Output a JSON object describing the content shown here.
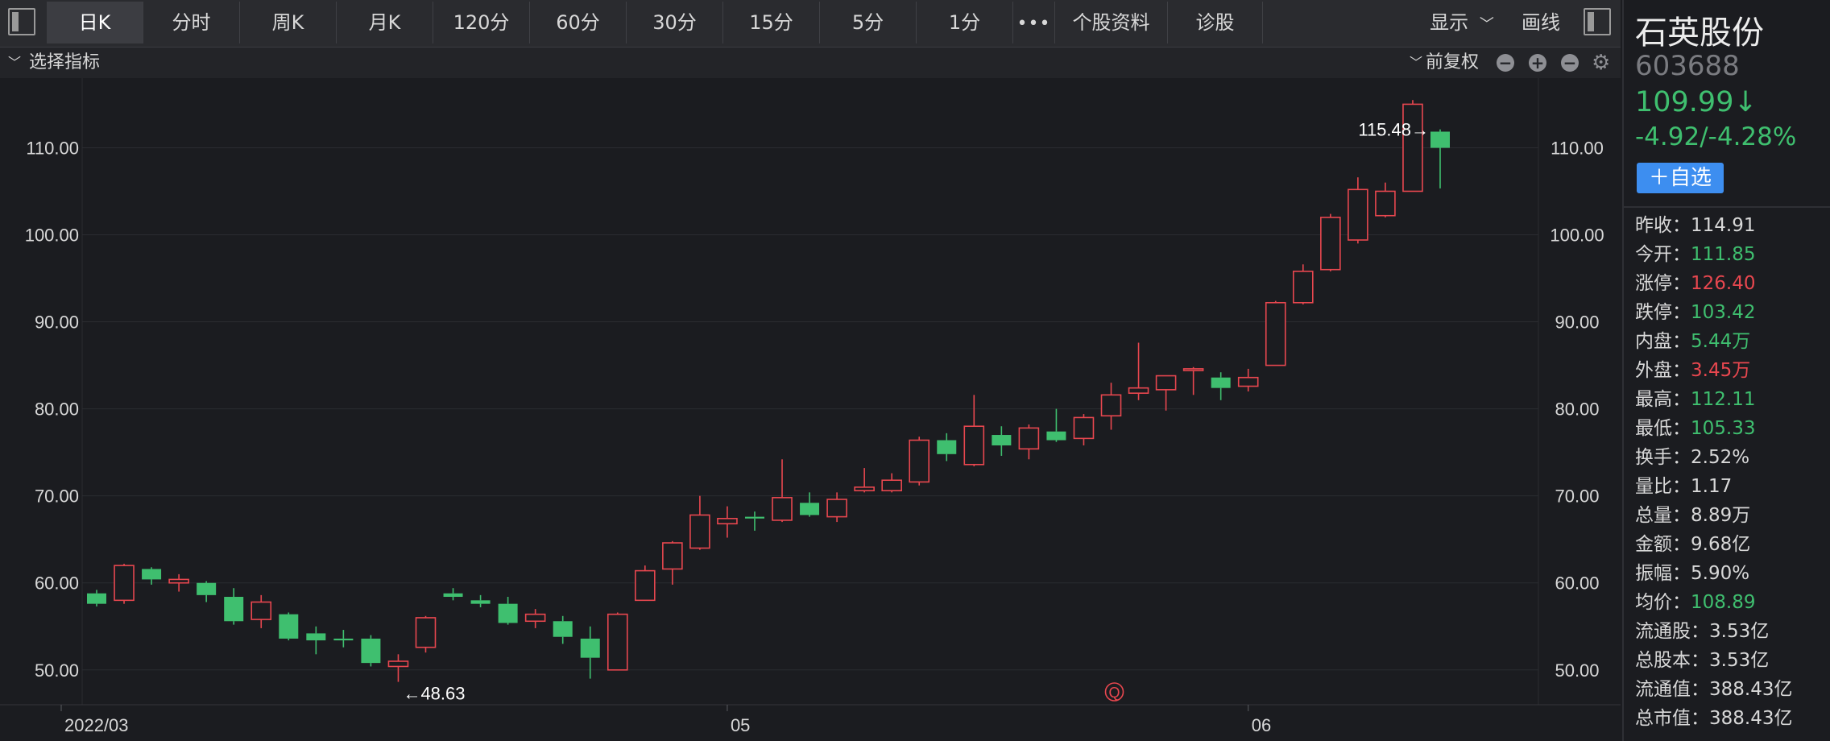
{
  "toolbar": {
    "tabs": [
      "日K",
      "分时",
      "周K",
      "月K",
      "120分",
      "60分",
      "30分",
      "15分",
      "5分",
      "1分"
    ],
    "active_tab": "日K",
    "more": "•••",
    "profile": "个股资料",
    "diagnose": "诊股",
    "display": "显示",
    "draw": "画线"
  },
  "subbar": {
    "indicator": "选择指标",
    "adjust": "前复权"
  },
  "chart_data": {
    "type": "candlestick",
    "ylim": [
      46,
      118
    ],
    "y_ticks": [
      "50.00",
      "60.00",
      "70.00",
      "80.00",
      "90.00",
      "100.00",
      "110.00"
    ],
    "x_labels": [
      {
        "index": 0,
        "label": "2022/03"
      },
      {
        "index": 23,
        "label": "05"
      },
      {
        "index": 42,
        "label": "06"
      }
    ],
    "max_marker": {
      "index": 49,
      "label": "115.48→"
    },
    "min_marker": {
      "index": 11,
      "label": "←48.63"
    },
    "event_marker": {
      "index": 37,
      "label": "Q"
    },
    "up_color": "#e8474f",
    "down_color": "#3fbf6f",
    "candles": [
      {
        "o": 58.8,
        "c": 57.6,
        "h": 59.2,
        "l": 57.3
      },
      {
        "o": 58.0,
        "c": 62.0,
        "h": 62.2,
        "l": 57.6
      },
      {
        "o": 61.6,
        "c": 60.4,
        "h": 61.8,
        "l": 59.8
      },
      {
        "o": 60.0,
        "c": 60.4,
        "h": 61.0,
        "l": 59.0
      },
      {
        "o": 60.0,
        "c": 58.6,
        "h": 60.2,
        "l": 57.8
      },
      {
        "o": 58.4,
        "c": 55.6,
        "h": 59.4,
        "l": 55.2
      },
      {
        "o": 55.8,
        "c": 57.8,
        "h": 58.6,
        "l": 54.8
      },
      {
        "o": 56.4,
        "c": 53.6,
        "h": 56.6,
        "l": 53.4
      },
      {
        "o": 54.2,
        "c": 53.4,
        "h": 55.0,
        "l": 51.8
      },
      {
        "o": 53.6,
        "c": 53.4,
        "h": 54.6,
        "l": 52.6
      },
      {
        "o": 53.6,
        "c": 50.8,
        "h": 54.0,
        "l": 50.4
      },
      {
        "o": 50.4,
        "c": 51.0,
        "h": 51.8,
        "l": 48.63
      },
      {
        "o": 52.6,
        "c": 56.0,
        "h": 56.2,
        "l": 52.0
      },
      {
        "o": 58.8,
        "c": 58.4,
        "h": 59.4,
        "l": 58.0
      },
      {
        "o": 58.0,
        "c": 57.6,
        "h": 58.6,
        "l": 57.2
      },
      {
        "o": 57.6,
        "c": 55.4,
        "h": 58.4,
        "l": 55.2
      },
      {
        "o": 55.6,
        "c": 56.4,
        "h": 57.0,
        "l": 54.8
      },
      {
        "o": 55.6,
        "c": 53.8,
        "h": 56.2,
        "l": 53.0
      },
      {
        "o": 53.6,
        "c": 51.4,
        "h": 55.0,
        "l": 49.0
      },
      {
        "o": 50.0,
        "c": 56.4,
        "h": 56.6,
        "l": 50.0
      },
      {
        "o": 58.0,
        "c": 61.4,
        "h": 62.0,
        "l": 58.0
      },
      {
        "o": 61.6,
        "c": 64.6,
        "h": 64.8,
        "l": 59.8
      },
      {
        "o": 64.0,
        "c": 67.8,
        "h": 70.0,
        "l": 63.8
      },
      {
        "o": 66.8,
        "c": 67.4,
        "h": 68.8,
        "l": 65.2
      },
      {
        "o": 67.6,
        "c": 67.4,
        "h": 68.2,
        "l": 66.0
      },
      {
        "o": 67.2,
        "c": 69.8,
        "h": 74.2,
        "l": 67.0
      },
      {
        "o": 69.2,
        "c": 67.8,
        "h": 70.4,
        "l": 67.6
      },
      {
        "o": 67.6,
        "c": 69.6,
        "h": 70.4,
        "l": 67.0
      },
      {
        "o": 70.6,
        "c": 71.0,
        "h": 73.2,
        "l": 70.4
      },
      {
        "o": 70.6,
        "c": 71.8,
        "h": 72.6,
        "l": 70.4
      },
      {
        "o": 71.6,
        "c": 76.4,
        "h": 76.8,
        "l": 71.2
      },
      {
        "o": 76.4,
        "c": 74.8,
        "h": 77.2,
        "l": 74.0
      },
      {
        "o": 73.6,
        "c": 78.0,
        "h": 81.6,
        "l": 73.4
      },
      {
        "o": 77.0,
        "c": 75.8,
        "h": 78.0,
        "l": 74.6
      },
      {
        "o": 75.4,
        "c": 77.8,
        "h": 78.2,
        "l": 74.2
      },
      {
        "o": 77.4,
        "c": 76.4,
        "h": 80.0,
        "l": 76.2
      },
      {
        "o": 76.6,
        "c": 79.0,
        "h": 79.4,
        "l": 75.8
      },
      {
        "o": 79.2,
        "c": 81.6,
        "h": 83.0,
        "l": 77.6
      },
      {
        "o": 81.8,
        "c": 82.4,
        "h": 87.6,
        "l": 81.0
      },
      {
        "o": 82.2,
        "c": 83.8,
        "h": 83.8,
        "l": 79.8
      },
      {
        "o": 84.4,
        "c": 84.6,
        "h": 84.8,
        "l": 81.6
      },
      {
        "o": 83.6,
        "c": 82.4,
        "h": 84.2,
        "l": 81.0
      },
      {
        "o": 82.6,
        "c": 83.6,
        "h": 84.6,
        "l": 82.0
      },
      {
        "o": 85.0,
        "c": 92.2,
        "h": 92.4,
        "l": 85.0
      },
      {
        "o": 92.2,
        "c": 95.8,
        "h": 96.6,
        "l": 92.0
      },
      {
        "o": 96.0,
        "c": 102.0,
        "h": 102.4,
        "l": 95.8
      },
      {
        "o": 99.4,
        "c": 105.2,
        "h": 106.6,
        "l": 99.0
      },
      {
        "o": 102.2,
        "c": 105.0,
        "h": 106.0,
        "l": 102.0
      },
      {
        "o": 105.0,
        "c": 115.0,
        "h": 115.48,
        "l": 105.0
      },
      {
        "o": 111.85,
        "c": 109.99,
        "h": 112.11,
        "l": 105.33
      }
    ]
  },
  "side": {
    "name": "石英股份",
    "code": "603688",
    "price": "109.99↓",
    "change": "-4.92/-4.28%",
    "watch_button": "＋自选",
    "stats": [
      {
        "label": "昨收：",
        "value": "114.91",
        "color": "#d8d8d8"
      },
      {
        "label": "今开：",
        "value": "111.85",
        "color": "#3fbf6f"
      },
      {
        "label": "涨停：",
        "value": "126.40",
        "color": "#e8474f"
      },
      {
        "label": "跌停：",
        "value": "103.42",
        "color": "#3fbf6f"
      },
      {
        "label": "内盘：",
        "value": "5.44万",
        "color": "#3fbf6f"
      },
      {
        "label": "外盘：",
        "value": "3.45万",
        "color": "#e8474f"
      },
      {
        "label": "最高：",
        "value": "112.11",
        "color": "#3fbf6f"
      },
      {
        "label": "最低：",
        "value": "105.33",
        "color": "#3fbf6f"
      },
      {
        "label": "换手：",
        "value": "2.52%",
        "color": "#d8d8d8"
      },
      {
        "label": "量比：",
        "value": "1.17",
        "color": "#d8d8d8"
      },
      {
        "label": "总量：",
        "value": "8.89万",
        "color": "#d8d8d8"
      },
      {
        "label": "金额：",
        "value": "9.68亿",
        "color": "#d8d8d8"
      },
      {
        "label": "振幅：",
        "value": "5.90%",
        "color": "#d8d8d8"
      },
      {
        "label": "均价：",
        "value": "108.89",
        "color": "#3fbf6f"
      },
      {
        "label": "流通股：",
        "value": "3.53亿",
        "color": "#d8d8d8"
      },
      {
        "label": "总股本：",
        "value": "3.53亿",
        "color": "#d8d8d8"
      },
      {
        "label": "流通值：",
        "value": "388.43亿",
        "color": "#d8d8d8"
      },
      {
        "label": "总市值：",
        "value": "388.43亿",
        "color": "#d8d8d8"
      }
    ]
  }
}
